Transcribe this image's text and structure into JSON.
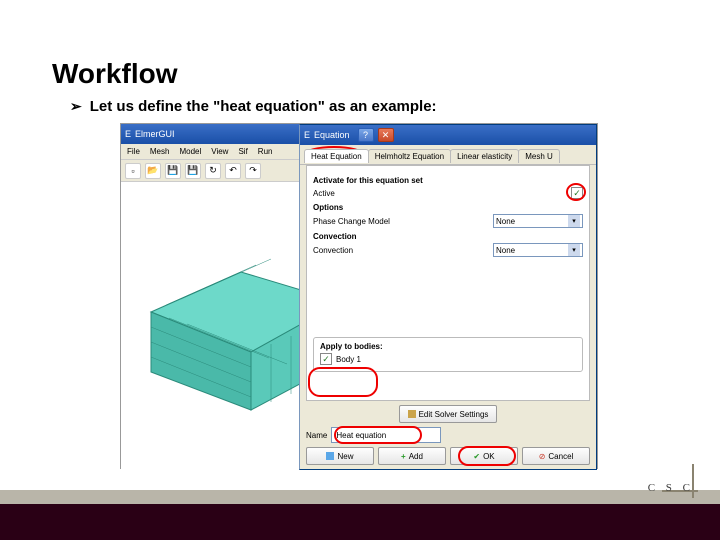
{
  "slide": {
    "title": "Workflow",
    "bullet_glyph": "➢",
    "bullet_text": "Let us define the \"heat equation\" as an example:"
  },
  "bg_window": {
    "title_prefix": "E",
    "title": "ElmerGUI",
    "menus": [
      "File",
      "Mesh",
      "Model",
      "View",
      "Sif",
      "Run"
    ],
    "toolbar_icons": [
      "new",
      "open",
      "save",
      "save",
      "refresh",
      "undo",
      "redo"
    ]
  },
  "dialog": {
    "title_prefix": "E",
    "title": "Equation",
    "tabs": [
      "Heat Equation",
      "Helmholtz Equation",
      "Linear elasticity",
      "Mesh U"
    ],
    "active_tab": 0,
    "sections": {
      "activate_header": "Activate for this equation set",
      "active_label": "Active",
      "active_checked": true,
      "options_header": "Options",
      "phase_label": "Phase Change Model",
      "phase_value": "None",
      "convection_header": "Convection",
      "convection_label": "Convection",
      "convection_value": "None",
      "bodies_header": "Apply to bodies:",
      "body1_label": "Body 1",
      "body1_checked": true
    },
    "edit_solver_label": "Edit Solver Settings",
    "name_label": "Name",
    "name_value": "Heat equation",
    "buttons": {
      "new_label": "New",
      "add_label": "Add",
      "ok_label": "OK",
      "cancel_label": "Cancel"
    }
  },
  "branding": {
    "csc": "C S C"
  }
}
